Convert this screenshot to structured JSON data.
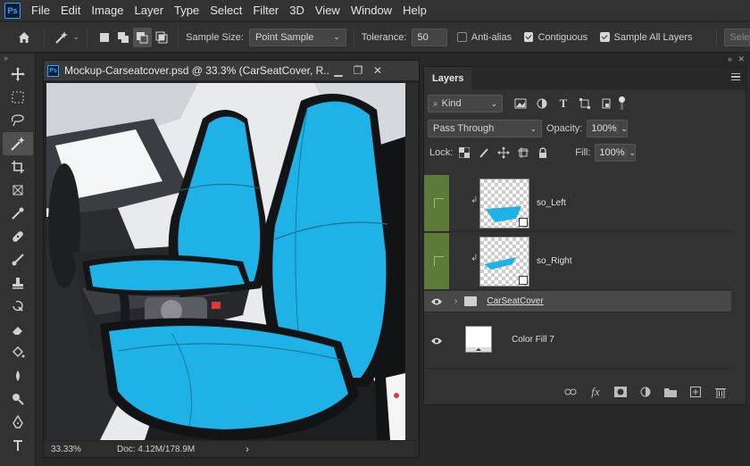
{
  "app": {
    "logo": "Ps"
  },
  "menu": [
    "File",
    "Edit",
    "Image",
    "Layer",
    "Type",
    "Select",
    "Filter",
    "3D",
    "View",
    "Window",
    "Help"
  ],
  "options": {
    "sample_size_label": "Sample Size:",
    "sample_size_value": "Point Sample",
    "tolerance_label": "Tolerance:",
    "tolerance_value": "50",
    "antialias_label": "Anti-alias",
    "antialias_checked": false,
    "contiguous_label": "Contiguous",
    "contiguous_checked": true,
    "sample_all_label": "Sample All Layers",
    "sample_all_checked": true,
    "select_subject_label": "Sele"
  },
  "tools": [
    "move-tool",
    "marquee-tool",
    "lasso-tool",
    "magic-wand-tool",
    "crop-tool",
    "frame-tool",
    "eyedropper-tool",
    "healing-brush-tool",
    "brush-tool",
    "clone-stamp-tool",
    "history-brush-tool",
    "eraser-tool",
    "paint-bucket-tool",
    "blur-tool",
    "dodge-tool",
    "pen-tool",
    "type-tool"
  ],
  "document": {
    "title": "Mockup-Carseatcover.psd @ 33.3% (CarSeatCover, R...",
    "zoom": "33.33%",
    "info": "Doc: 4.12M/178.9M",
    "info_arrow": "›",
    "seat_color": "#1fb2e6"
  },
  "layers_panel": {
    "tab": "Layers",
    "filter_kind": "Kind",
    "blend_mode": "Pass Through",
    "opacity_label": "Opacity:",
    "opacity_value": "100%",
    "lock_label": "Lock:",
    "fill_label": "Fill:",
    "fill_value": "100%",
    "layers": [
      {
        "name": "so_Left",
        "visible": false,
        "clipped": true,
        "type": "smart-object"
      },
      {
        "name": "so_Right",
        "visible": false,
        "clipped": true,
        "type": "smart-object"
      },
      {
        "name": "CarSeatCover",
        "visible": true,
        "type": "group",
        "selected": true
      },
      {
        "name": "Color Fill 7",
        "visible": true,
        "type": "fill"
      }
    ],
    "highlight_color": "#5c7a38"
  }
}
